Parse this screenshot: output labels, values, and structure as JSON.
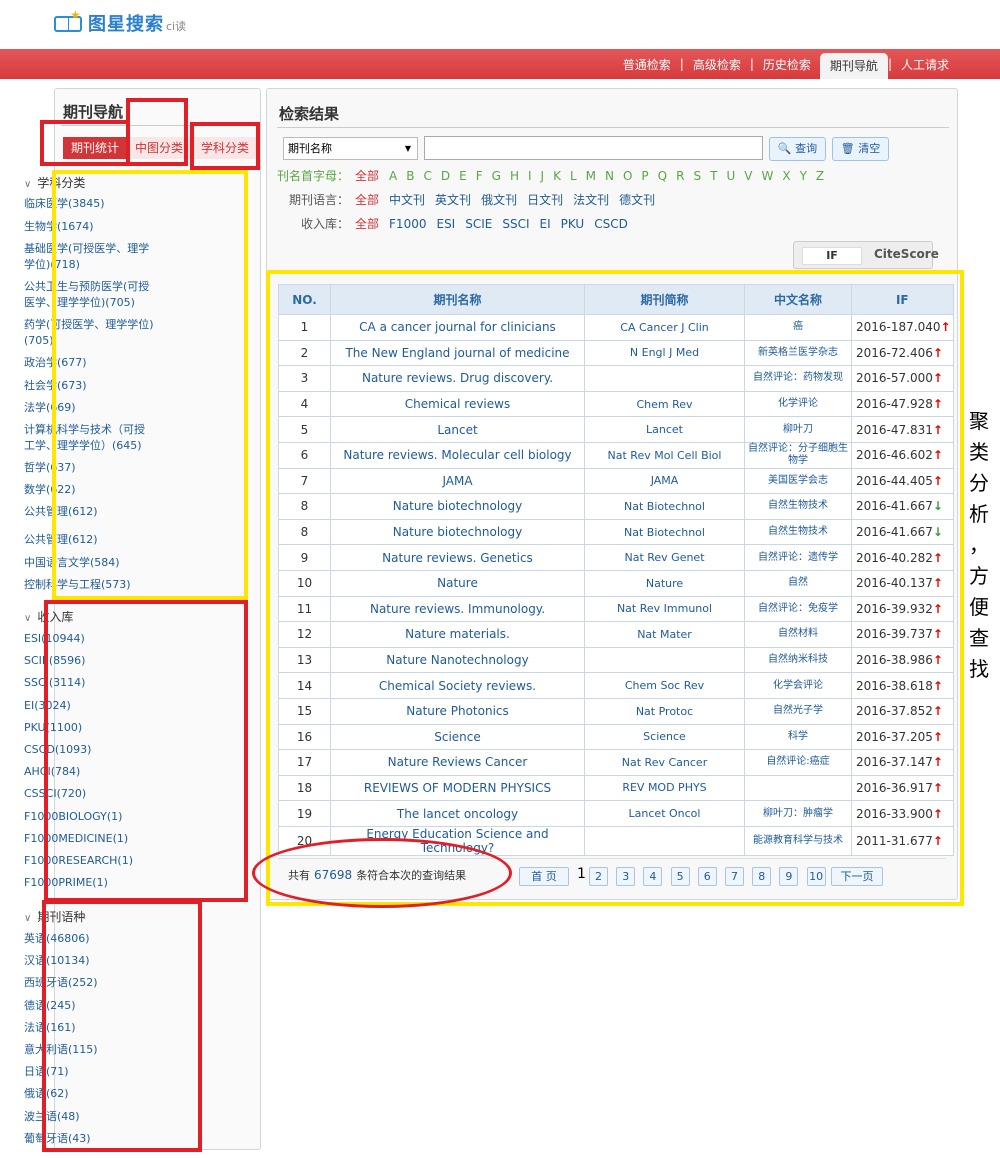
{
  "header": {
    "logo_text": "图星搜索",
    "logo_sub": "ci读",
    "nav": [
      "普通检索",
      "高级检索",
      "历史检索",
      "期刊导航",
      "人工请求"
    ],
    "nav_active": "期刊导航"
  },
  "sidebar": {
    "title": "期刊导航",
    "tabs": [
      "期刊统计",
      "中图分类",
      "学科分类"
    ],
    "subject_title": "学科分类",
    "subjects": [
      "临床医学(3845)",
      "生物学(1674)",
      "基础医学(可授医学、理学学位)(718)",
      "公共卫生与预防医学(可授医学、理学学位)(705)",
      "药学(可授医学、理学学位)(705)",
      "政治学(677)",
      "社会学(673)",
      "法学(669)",
      "计算机科学与技术（可授工学、理学学位）(645)",
      "哲学(637)",
      "数学(622)",
      "公共管理(612)",
      "公共管理(612)",
      "中国语言文学(584)",
      "控制科学与工程(573)"
    ],
    "db_title": "收入库",
    "dbs": [
      "ESI(10944)",
      "SCIE(8596)",
      "SSCI(3114)",
      "EI(3024)",
      "PKU(1100)",
      "CSCD(1093)",
      "AHCI(784)",
      "CSSCI(720)",
      "F1000BIOLOGY(1)",
      "F1000MEDICINE(1)",
      "F1000RESEARCH(1)",
      "F1000PRIME(1)"
    ],
    "lang_title": "期刊语种",
    "langs": [
      "英语(46806)",
      "汉语(10134)",
      "西班牙语(252)",
      "德语(245)",
      "法语(161)",
      "意大利语(115)",
      "日语(71)",
      "俄语(62)",
      "波兰语(48)",
      "葡萄牙语(43)"
    ]
  },
  "main": {
    "title": "检索结果",
    "select_value": "期刊名称",
    "search_value": "",
    "btn_query": "查询",
    "btn_clear": "清空",
    "letter_label": "刊名首字母：",
    "letter_all": "全部",
    "letters": [
      "A",
      "B",
      "C",
      "D",
      "E",
      "F",
      "G",
      "H",
      "I",
      "J",
      "K",
      "L",
      "M",
      "N",
      "O",
      "P",
      "Q",
      "R",
      "S",
      "T",
      "U",
      "V",
      "W",
      "X",
      "Y",
      "Z"
    ],
    "lang_label": "期刊语言：",
    "lang_opts": [
      "全部",
      "中文刊",
      "英文刊",
      "俄文刊",
      "日文刊",
      "法文刊",
      "德文刊"
    ],
    "db_label": "收入库：",
    "db_opts": [
      "全部",
      "F1000",
      "ESI",
      "SCIE",
      "SSCI",
      "EI",
      "PKU",
      "CSCD"
    ],
    "sort_if": "IF",
    "sort_citescore": "CiteScore",
    "columns": [
      "NO.",
      "期刊名称",
      "期刊简称",
      "中文名称",
      "IF"
    ],
    "rows": [
      {
        "no": "1",
        "name": "CA a cancer journal for clinicians",
        "abbr": "CA Cancer J Clin",
        "cn": "癌",
        "if": "2016-187.040",
        "trend": "up"
      },
      {
        "no": "2",
        "name": "The New England journal of medicine",
        "abbr": "N Engl J Med",
        "cn": "新英格兰医学杂志",
        "if": "2016-72.406",
        "trend": "up"
      },
      {
        "no": "3",
        "name": "Nature reviews. Drug discovery.",
        "abbr": "",
        "cn": "自然评论：药物发现",
        "if": "2016-57.000",
        "trend": "up"
      },
      {
        "no": "4",
        "name": "Chemical reviews",
        "abbr": "Chem Rev",
        "cn": "化学评论",
        "if": "2016-47.928",
        "trend": "up"
      },
      {
        "no": "5",
        "name": "Lancet",
        "abbr": "Lancet",
        "cn": "柳叶刀",
        "if": "2016-47.831",
        "trend": "up"
      },
      {
        "no": "6",
        "name": "Nature reviews. Molecular cell biology",
        "abbr": "Nat Rev Mol Cell Biol",
        "cn": "自然评论：分子细胞生物学",
        "if": "2016-46.602",
        "trend": "up"
      },
      {
        "no": "7",
        "name": "JAMA",
        "abbr": "JAMA",
        "cn": "美国医学会志",
        "if": "2016-44.405",
        "trend": "up"
      },
      {
        "no": "8",
        "name": "Nature biotechnology",
        "abbr": "Nat Biotechnol",
        "cn": "自然生物技术",
        "if": "2016-41.667",
        "trend": "down"
      },
      {
        "no": "8",
        "name": "Nature biotechnology",
        "abbr": "Nat Biotechnol",
        "cn": "自然生物技术",
        "if": "2016-41.667",
        "trend": "down"
      },
      {
        "no": "9",
        "name": "Nature reviews. Genetics",
        "abbr": "Nat Rev Genet",
        "cn": "自然评论：遗传学",
        "if": "2016-40.282",
        "trend": "up"
      },
      {
        "no": "10",
        "name": "Nature",
        "abbr": "Nature",
        "cn": "自然",
        "if": "2016-40.137",
        "trend": "up"
      },
      {
        "no": "11",
        "name": "Nature reviews. Immunology.",
        "abbr": "Nat Rev Immunol",
        "cn": "自然评论：免疫学",
        "if": "2016-39.932",
        "trend": "up"
      },
      {
        "no": "12",
        "name": "Nature materials.",
        "abbr": "Nat Mater",
        "cn": "自然材料",
        "if": "2016-39.737",
        "trend": "up"
      },
      {
        "no": "13",
        "name": "Nature Nanotechnology",
        "abbr": "",
        "cn": "自然纳米科技",
        "if": "2016-38.986",
        "trend": "up"
      },
      {
        "no": "14",
        "name": "Chemical Society reviews.",
        "abbr": "Chem Soc Rev",
        "cn": "化学会评论",
        "if": "2016-38.618",
        "trend": "up"
      },
      {
        "no": "15",
        "name": "Nature Photonics",
        "abbr": "Nat Protoc",
        "cn": "自然光子学",
        "if": "2016-37.852",
        "trend": "up"
      },
      {
        "no": "16",
        "name": "Science",
        "abbr": "Science",
        "cn": "科学",
        "if": "2016-37.205",
        "trend": "up"
      },
      {
        "no": "17",
        "name": "Nature Reviews Cancer",
        "abbr": "Nat Rev Cancer",
        "cn": "自然评论:癌症",
        "if": "2016-37.147",
        "trend": "up"
      },
      {
        "no": "18",
        "name": "REVIEWS OF MODERN PHYSICS",
        "abbr": "REV MOD PHYS",
        "cn": "",
        "if": "2016-36.917",
        "trend": "up"
      },
      {
        "no": "19",
        "name": "The lancet oncology",
        "abbr": "Lancet Oncol",
        "cn": "柳叶刀：肿瘤学",
        "if": "2016-33.900",
        "trend": "up"
      },
      {
        "no": "20",
        "name": "Energy Education Science and Technology?",
        "abbr": "",
        "cn": "能源教育科学与技术",
        "if": "2011-31.677",
        "trend": "up"
      }
    ],
    "total_prefix": "共有",
    "total_count": "67698",
    "total_suffix": "条符合本次的查询结果",
    "first_page": "首 页",
    "current_page": "1",
    "pages": [
      "2",
      "3",
      "4",
      "5",
      "6",
      "7",
      "8",
      "9",
      "10"
    ],
    "next_page": "下一页"
  },
  "annotation": {
    "side_note": "聚类分析，方便查找"
  },
  "colors": {
    "brand_red": "#d63a3c",
    "link_blue": "#1f5b99",
    "letter_green": "#5aa644",
    "annotation_red": "#e01f26",
    "annotation_yellow": "#ffe600"
  }
}
